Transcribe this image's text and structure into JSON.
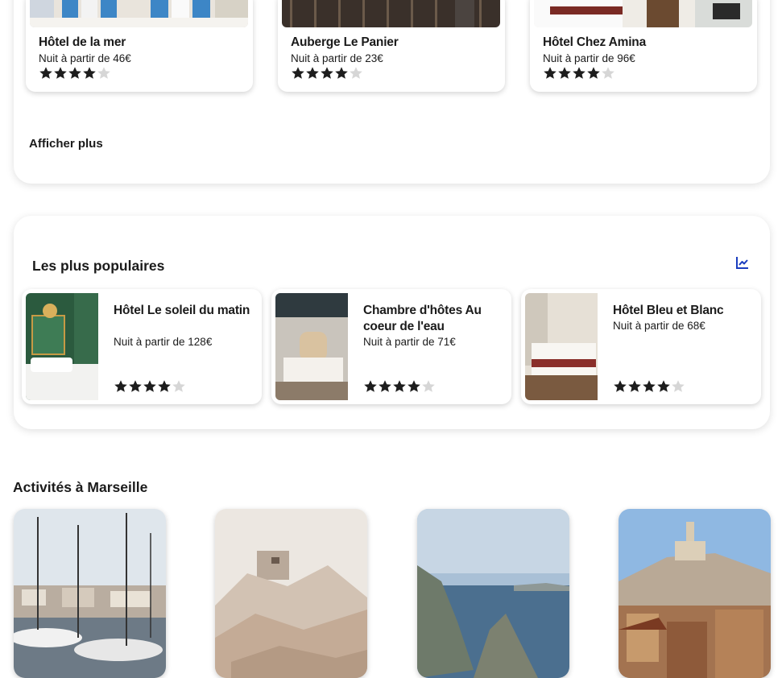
{
  "top_hotels": [
    {
      "name": "Hôtel de la mer",
      "price": "Nuit à partir de 46€",
      "rating": 4
    },
    {
      "name": "Auberge Le Panier",
      "price": "Nuit à partir de 23€",
      "rating": 4
    },
    {
      "name": "Hôtel Chez Amina",
      "price": "Nuit à partir de 96€",
      "rating": 4
    }
  ],
  "show_more_label": "Afficher plus",
  "popular": {
    "title": "Les plus populaires",
    "icon": "trending-chart-icon",
    "hotels": [
      {
        "name": "Hôtel Le soleil du matin",
        "price": "Nuit à partir de 128€",
        "rating": 4
      },
      {
        "name": "Chambre d'hôtes Au coeur de l'eau",
        "price": "Nuit à partir de 71€",
        "rating": 4
      },
      {
        "name": "Hôtel Bleu et Blanc",
        "price": "Nuit à partir de 68€",
        "rating": 4
      }
    ]
  },
  "activities": {
    "title": "Activités à Marseille",
    "images": [
      "harbor-boats-photo",
      "rocky-fort-photo",
      "calanques-sea-photo",
      "city-basilica-photo"
    ]
  },
  "colors": {
    "text": "#1b1b1b",
    "star_filled": "#1d1d1d",
    "star_empty": "#d6d6d6",
    "accent": "#1a3dbf"
  }
}
